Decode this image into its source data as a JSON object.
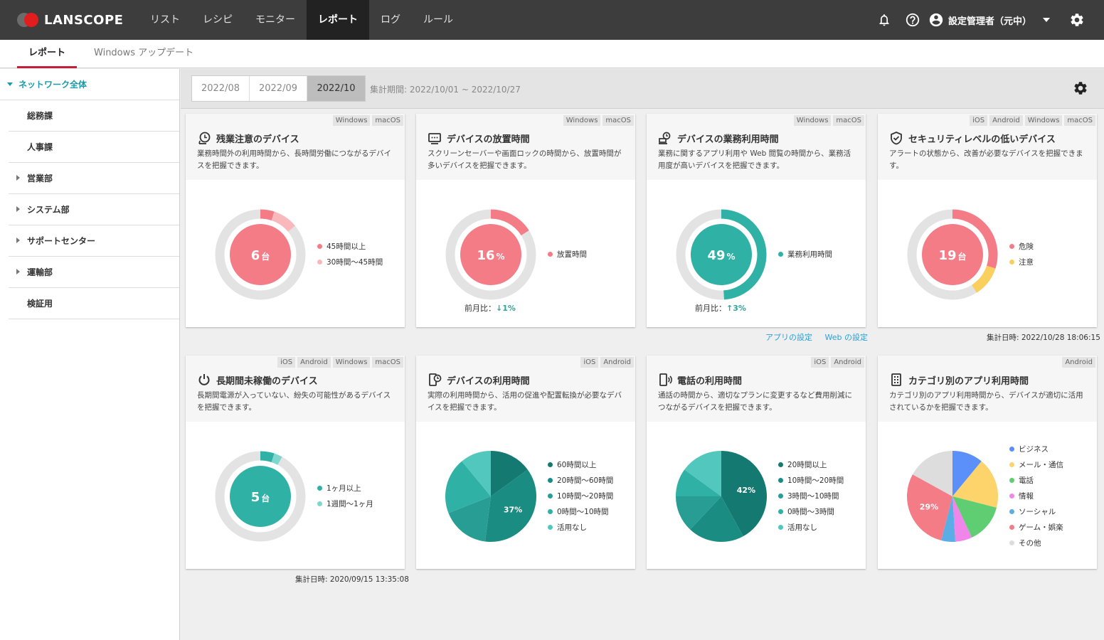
{
  "header": {
    "logo_text": "LANSCOPE",
    "nav": [
      "リスト",
      "レシピ",
      "モニター",
      "レポート",
      "ログ",
      "ルール"
    ],
    "active_nav": 3,
    "user_name": "設定管理者（元中）"
  },
  "subtabs": [
    "レポート",
    "Windows アップデート"
  ],
  "sidebar": {
    "root": "ネットワーク全体",
    "items": [
      {
        "label": "総務課",
        "expandable": false
      },
      {
        "label": "人事課",
        "expandable": false
      },
      {
        "label": "営業部",
        "expandable": true
      },
      {
        "label": "システム部",
        "expandable": true
      },
      {
        "label": "サポートセンター",
        "expandable": true
      },
      {
        "label": "運輸部",
        "expandable": true
      },
      {
        "label": "検証用",
        "expandable": false
      }
    ]
  },
  "period": {
    "tabs": [
      "2022/08",
      "2022/09",
      "2022/10"
    ],
    "active": 2,
    "text": "集計期間: 2022/10/01 ~ 2022/10/27"
  },
  "colors": {
    "pink": "#f47c86",
    "light_pink": "#f9b8bb",
    "teal": "#2fb1a6",
    "light_teal": "#7fd6cf",
    "yellow": "#f9cf5e",
    "ring_bg": "#e3e3e3"
  },
  "cards": [
    {
      "title": "残業注意のデバイス",
      "icon": "overtime-clock-icon",
      "chips": [
        "Windows",
        "macOS"
      ],
      "desc": "業務時間外の利用時間から、長時間労働につながるデバイスを把握できます。",
      "center_num": "6",
      "center_unit": "台",
      "legend": [
        {
          "label": "45時間以上",
          "color": "#f47c86"
        },
        {
          "label": "30時間〜45時間",
          "color": "#f9b8bb"
        }
      ]
    },
    {
      "title": "デバイスの放置時間",
      "icon": "screen-idle-icon",
      "chips": [
        "Windows",
        "macOS"
      ],
      "desc": "スクリーンセーバーや画面ロックの時間から、放置時間が多いデバイスを把握できます。",
      "center_num": "16",
      "center_unit": "%",
      "legend": [
        {
          "label": "放置時間",
          "color": "#f47c86"
        }
      ],
      "compare_label": "前月比：",
      "compare_val": "↓1%"
    },
    {
      "title": "デバイスの業務利用時間",
      "icon": "work-usage-icon",
      "chips": [
        "Windows",
        "macOS"
      ],
      "desc": "業務に関するアプリ利用や Web 閲覧の時間から、業務活用度が高いデバイスを把握できます。",
      "center_num": "49",
      "center_unit": "%",
      "legend": [
        {
          "label": "業務利用時間",
          "color": "#2fb1a6"
        }
      ],
      "compare_label": "前月比：",
      "compare_val": "↑3%"
    },
    {
      "title": "セキュリティレベルの低いデバイス",
      "icon": "shield-check-icon",
      "chips": [
        "iOS",
        "Android",
        "Windows",
        "macOS"
      ],
      "desc": "アラートの状態から、改善が必要なデバイスを把握できます。",
      "center_num": "19",
      "center_unit": "台",
      "legend": [
        {
          "label": "危険",
          "color": "#f47c86"
        },
        {
          "label": "注意",
          "color": "#f9cf5e"
        }
      ]
    },
    {
      "title": "長期間未稼働のデバイス",
      "icon": "power-icon",
      "chips": [
        "iOS",
        "Android",
        "Windows",
        "macOS"
      ],
      "desc": "長期間電源が入っていない、紛失の可能性があるデバイスを把握できます。",
      "center_num": "5",
      "center_unit": "台",
      "legend": [
        {
          "label": "1ヶ月以上",
          "color": "#2fb1a6"
        },
        {
          "label": "1週間〜1ヶ月",
          "color": "#7fd6cf"
        }
      ]
    },
    {
      "title": "デバイスの利用時間",
      "icon": "device-usage-icon",
      "chips": [
        "iOS",
        "Android"
      ],
      "desc": "実際の利用時間から、活用の促進や配置転換が必要なデバイスを把握できます。",
      "pie_label": "37%",
      "legend": [
        {
          "label": "60時間以上",
          "color": "#147a71"
        },
        {
          "label": "20時間〜60時間",
          "color": "#1a8c82"
        },
        {
          "label": "10時間〜20時間",
          "color": "#279d94"
        },
        {
          "label": "0時間〜10時間",
          "color": "#2fb1a6"
        },
        {
          "label": "活用なし",
          "color": "#52c7bd"
        }
      ]
    },
    {
      "title": "電話の利用時間",
      "icon": "phone-call-icon",
      "chips": [
        "iOS",
        "Android"
      ],
      "desc": "通話の時間から、適切なプランに変更するなど費用削減につながるデバイスを把握できます。",
      "pie_label": "42%",
      "legend": [
        {
          "label": "20時間以上",
          "color": "#147a71"
        },
        {
          "label": "10時間〜20時間",
          "color": "#1a8c82"
        },
        {
          "label": "3時間〜10時間",
          "color": "#279d94"
        },
        {
          "label": "0時間〜3時間",
          "color": "#2fb1a6"
        },
        {
          "label": "活用なし",
          "color": "#52c7bd"
        }
      ]
    },
    {
      "title": "カテゴリ別のアプリ利用時間",
      "icon": "app-category-icon",
      "chips": [
        "Android"
      ],
      "desc": "カテゴリ別のアプリ利用時間から、デバイスが適切に活用されているかを把握できます。",
      "pie_label": "29%",
      "legend": [
        {
          "label": "ビジネス",
          "color": "#5b8ff9"
        },
        {
          "label": "メール・通信",
          "color": "#fdd36b"
        },
        {
          "label": "電話",
          "color": "#5fce73"
        },
        {
          "label": "情報",
          "color": "#f086ea"
        },
        {
          "label": "ソーシャル",
          "color": "#5aaee5"
        },
        {
          "label": "ゲーム・娯楽",
          "color": "#f47c86"
        },
        {
          "label": "その他",
          "color": "#dddddd"
        }
      ]
    }
  ],
  "links": [
    "アプリの設定",
    "Web の設定"
  ],
  "agg_row1": "集計日時: 2022/10/28 18:06:15",
  "agg_row2": "集計日時: 2020/09/15 13:35:08",
  "chart_data": [
    {
      "type": "pie",
      "title": "残業注意のデバイス",
      "categories": [
        "45時間以上",
        "30時間〜45時間"
      ],
      "values": [
        5,
        9
      ],
      "max": 100,
      "center": "6台"
    },
    {
      "type": "pie",
      "title": "デバイスの放置時間",
      "categories": [
        "放置時間"
      ],
      "values": [
        16
      ],
      "max": 100,
      "center": "16%",
      "compare": "↓1%"
    },
    {
      "type": "pie",
      "title": "デバイスの業務利用時間",
      "categories": [
        "業務利用時間"
      ],
      "values": [
        49
      ],
      "max": 100,
      "center": "49%",
      "compare": "↑3%"
    },
    {
      "type": "pie",
      "title": "セキュリティレベルの低いデバイス",
      "categories": [
        "危険",
        "注意"
      ],
      "values": [
        30,
        11
      ],
      "max": 100,
      "center": "19台"
    },
    {
      "type": "pie",
      "title": "長期間未稼働のデバイス",
      "categories": [
        "1ヶ月以上",
        "1週間〜1ヶ月"
      ],
      "values": [
        5,
        3
      ],
      "max": 100,
      "center": "5台"
    },
    {
      "type": "pie",
      "title": "デバイスの利用時間",
      "categories": [
        "60時間以上",
        "20時間〜60時間",
        "10時間〜20時間",
        "0時間〜10時間",
        "活用なし"
      ],
      "values": [
        15,
        37,
        17,
        20,
        11
      ]
    },
    {
      "type": "pie",
      "title": "電話の利用時間",
      "categories": [
        "20時間以上",
        "10時間〜20時間",
        "3時間〜10時間",
        "0時間〜3時間",
        "活用なし"
      ],
      "values": [
        42,
        20,
        13,
        10,
        15
      ]
    },
    {
      "type": "pie",
      "title": "カテゴリ別のアプリ利用時間",
      "categories": [
        "ビジネス",
        "メール・通信",
        "電話",
        "情報",
        "ソーシャル",
        "ゲーム・娯楽",
        "その他"
      ],
      "values": [
        11,
        18,
        14,
        6,
        5,
        29,
        17
      ]
    }
  ]
}
